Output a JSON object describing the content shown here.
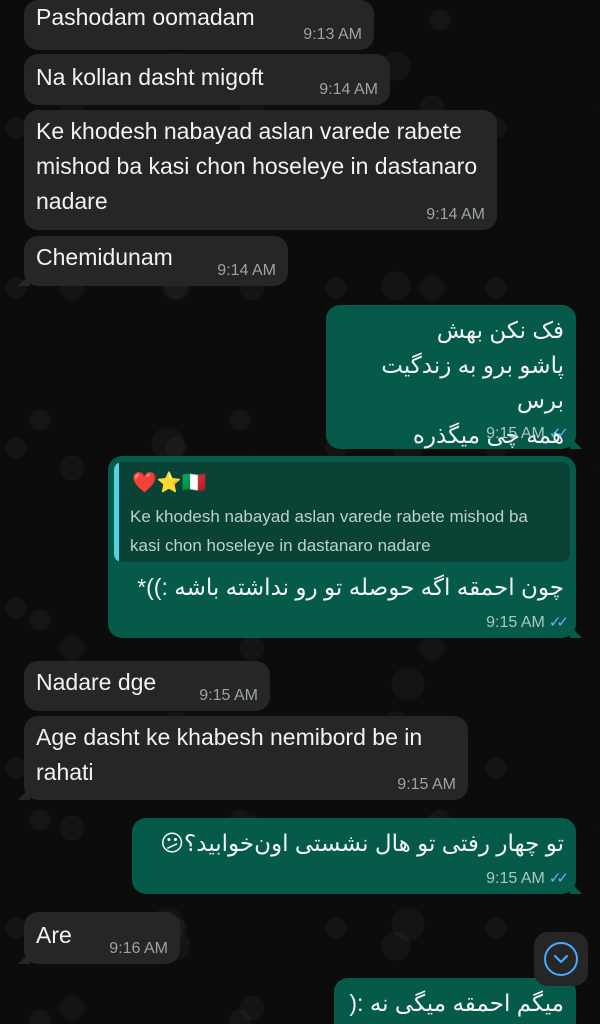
{
  "messages": [
    {
      "direction": "in",
      "text": "Pashodam oomadam",
      "time": "9:13 AM"
    },
    {
      "direction": "in",
      "text": "Na kollan dasht migoft",
      "time": "9:14 AM"
    },
    {
      "direction": "in",
      "text": "Ke khodesh nabayad aslan varede rabete mishod ba kasi chon hoseleye in dastanaro nadare",
      "time": "9:14 AM"
    },
    {
      "direction": "in",
      "text": "Chemidunam",
      "time": "9:14 AM"
    },
    {
      "direction": "out",
      "lines": [
        "فک نکن بهش",
        "پاشو برو به زندگیت برس",
        "همه چی میگذره"
      ],
      "time": "9:15 AM",
      "status": "read"
    },
    {
      "direction": "out",
      "reply_to": {
        "emoji": "❤️⭐🇮🇹",
        "text": "Ke khodesh nabayad aslan varede rabete mishod ba kasi chon hoseleye in dastanaro nadare"
      },
      "text": "چون احمقه اگه حوصله تو رو نداشته باشه :))*",
      "time": "9:15 AM",
      "status": "read"
    },
    {
      "direction": "in",
      "text": "Nadare dge",
      "time": "9:15 AM"
    },
    {
      "direction": "in",
      "text": "Age dasht ke khabesh nemibord be in rahati",
      "time": "9:15 AM"
    },
    {
      "direction": "out",
      "text": "تو چهار رفتی تو هال نشستی اون‌خوابید؟😕",
      "time": "9:15 AM",
      "status": "read"
    },
    {
      "direction": "in",
      "text": "Are",
      "time": "9:16 AM"
    },
    {
      "direction": "out",
      "text": "میگم احمقه میگی نه :(",
      "time": "",
      "status": ""
    }
  ],
  "icons": {
    "read_receipt": "double-check-icon",
    "scroll_down": "chevron-down-icon"
  },
  "colors": {
    "incoming_bubble": "#262626",
    "outgoing_bubble": "#065a4a",
    "read_ticks": "#5fb7ff",
    "quote_bar": "#4fd5e8",
    "background": "#0c0c0c"
  }
}
